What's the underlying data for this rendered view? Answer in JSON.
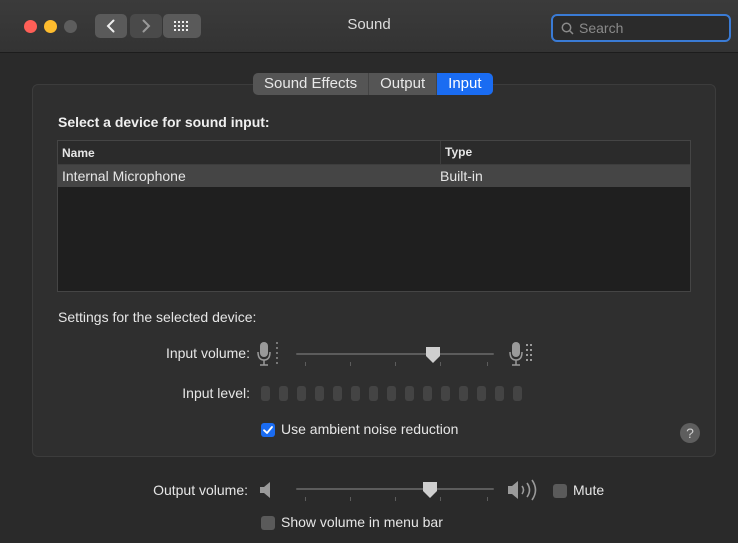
{
  "window": {
    "title": "Sound"
  },
  "search": {
    "placeholder": "Search"
  },
  "tabs": [
    {
      "label": "Sound Effects",
      "active": false
    },
    {
      "label": "Output",
      "active": false
    },
    {
      "label": "Input",
      "active": true
    }
  ],
  "input": {
    "select_title": "Select a device for sound input:",
    "columns": {
      "name": "Name",
      "type": "Type"
    },
    "devices": [
      {
        "name": "Internal Microphone",
        "type": "Built-in",
        "selected": true
      }
    ],
    "settings_title": "Settings for the selected device:",
    "input_volume_label": "Input volume:",
    "input_volume_value": 0.7,
    "input_level_label": "Input level:",
    "input_level_segments": 15,
    "noise_reduction_label": "Use ambient noise reduction",
    "noise_reduction_checked": true
  },
  "output": {
    "volume_label": "Output volume:",
    "volume_value": 0.67,
    "mute_label": "Mute",
    "mute_checked": false,
    "show_in_menu_bar_label": "Show volume in menu bar",
    "show_in_menu_bar_checked": false
  },
  "help": {
    "label": "?"
  },
  "colors": {
    "accent": "#1a6cf2",
    "window_bg": "#2a2a2a"
  }
}
